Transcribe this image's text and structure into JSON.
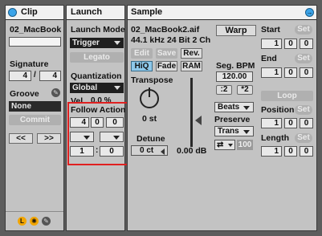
{
  "clip": {
    "title": "Clip",
    "name": "02_MacBook",
    "signature_label": "Signature",
    "signature_num": "4",
    "signature_den": "4",
    "signature_slash": "/",
    "groove_label": "Groove",
    "groove_value": "None",
    "commit_label": "Commit",
    "nudge_back": "<<",
    "nudge_forward": ">>",
    "footer_badge": "L"
  },
  "launch": {
    "title": "Launch",
    "mode_label": "Launch Mode",
    "mode_value": "Trigger",
    "legato_label": "Legato",
    "quantization_label": "Quantization",
    "quantization_value": "Global",
    "vel_label": "Vel",
    "vel_value": "0.0 %",
    "follow_action_label": "Follow Action",
    "follow_time": [
      "4",
      "0",
      "0"
    ],
    "chance_a": "1",
    "chance_sep": ":",
    "chance_b": "0",
    "highlight_color": "#e02020"
  },
  "sample": {
    "title": "Sample",
    "filename": "02_MacBook2.aif",
    "format": "44.1 kHz 24 Bit 2 Ch",
    "edit_label": "Edit",
    "save_label": "Save",
    "rev_label": "Rev.",
    "hiq_label": "HiQ",
    "fade_label": "Fade",
    "ram_label": "RAM",
    "transpose_label": "Transpose",
    "transpose_value": "0 st",
    "detune_label": "Detune",
    "detune_value": "0 ct",
    "gain_value": "0.00 dB",
    "warp_label": "Warp",
    "seg_bpm_label": "Seg. BPM",
    "seg_bpm_value": "120.00",
    "half_label": ":2",
    "double_label": "*2",
    "warp_mode": "Beats",
    "preserve_label": "Preserve",
    "preserve_value": "Trans",
    "loop_mode_value": "100",
    "start_label": "Start",
    "set_label": "Set",
    "start_values": [
      "1",
      "0",
      "0"
    ],
    "end_label": "End",
    "end_values": [
      "1",
      "0",
      "0"
    ],
    "loop_label": "Loop",
    "position_label": "Position",
    "position_values": [
      "1",
      "0",
      "0"
    ],
    "length_label": "Length",
    "length_values": [
      "1",
      "0",
      "0"
    ]
  }
}
